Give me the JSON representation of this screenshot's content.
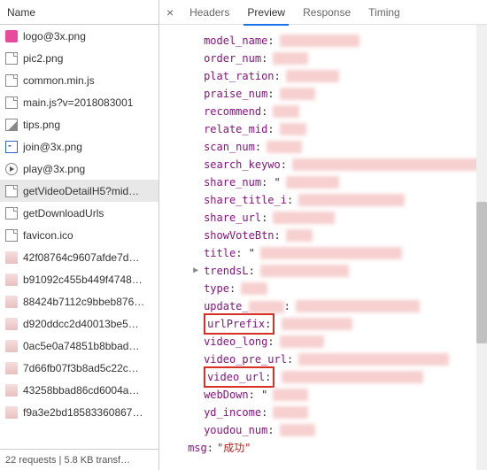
{
  "sidebar": {
    "header": "Name",
    "files": [
      {
        "name": "logo@3x.png",
        "icon": "pink"
      },
      {
        "name": "pic2.png",
        "icon": "doc"
      },
      {
        "name": "common.min.js",
        "icon": "doc"
      },
      {
        "name": "main.js?v=2018083001",
        "icon": "doc"
      },
      {
        "name": "tips.png",
        "icon": "img"
      },
      {
        "name": "join@3x.png",
        "icon": "join"
      },
      {
        "name": "play@3x.png",
        "icon": "play"
      },
      {
        "name": "getVideoDetailH5?mid…",
        "icon": "doc",
        "selected": true
      },
      {
        "name": "getDownloadUrls",
        "icon": "doc"
      },
      {
        "name": "favicon.ico",
        "icon": "doc"
      },
      {
        "name": "42f08764c9607afde7d…",
        "icon": "thumb"
      },
      {
        "name": "b91092c455b449f4748…",
        "icon": "thumb"
      },
      {
        "name": "88424b7112c9bbeb876…",
        "icon": "thumb"
      },
      {
        "name": "d920ddcc2d40013be5…",
        "icon": "thumb"
      },
      {
        "name": "0ac5e0a74851b8bbad…",
        "icon": "thumb"
      },
      {
        "name": "7d66fb07f3b8ad5c22c…",
        "icon": "thumb"
      },
      {
        "name": "43258bbad86cd6004a…",
        "icon": "thumb"
      },
      {
        "name": "f9a3e2bd18583360867…",
        "icon": "thumb"
      }
    ],
    "footer": "22 requests  |  5.8 KB transf…"
  },
  "tabs": {
    "close": "×",
    "items": [
      "Headers",
      "Preview",
      "Response",
      "Timing"
    ],
    "active": 1
  },
  "preview": {
    "props": [
      {
        "key": "model_name",
        "colon": ":",
        "censor": 90
      },
      {
        "key": "order_num",
        "colon": ":",
        "censor": 40
      },
      {
        "key": "plat_ration",
        "colon": ":",
        "censor": 60
      },
      {
        "key": "praise_num",
        "colon": ":",
        "censor": 40
      },
      {
        "key": "recommend",
        "colon": ":",
        "censor": 30
      },
      {
        "key": "relate_mid",
        "colon": ":",
        "censor": 30
      },
      {
        "key": "scan_num",
        "colon": ":",
        "censor": 40
      },
      {
        "key": "search_keywo",
        "colon": ":",
        "censor": 220
      },
      {
        "key": "share_num",
        "colon": ": \"",
        "censor": 60
      },
      {
        "key": "share_title_i",
        "colon": ":",
        "censor": 120
      },
      {
        "key": "share_url",
        "colon": ":",
        "censor": 70
      },
      {
        "key": "showVoteBtn",
        "colon": ":",
        "censor": 30
      },
      {
        "key": "title",
        "colon": ": \"",
        "censor": 160
      },
      {
        "key": "trendsL",
        "colon": ":",
        "censor": 100,
        "expand": true
      },
      {
        "key": "type",
        "colon": ":",
        "censor": 30
      },
      {
        "key": "update_",
        "colon": ":",
        "censor": 140,
        "keycensor": 40
      },
      {
        "key": "urlPrefix",
        "colon": ":",
        "censor": 80,
        "boxed": true
      },
      {
        "key": "video_long",
        "colon": ":",
        "censor": 50
      },
      {
        "key": "video_pre_url",
        "colon": ":",
        "censor": 170
      },
      {
        "key": "video_url",
        "colon": ":",
        "censor": 160,
        "boxed": true
      },
      {
        "key": "webDown",
        "colon": ": \"",
        "censor": 40
      },
      {
        "key": "yd_income",
        "colon": ":",
        "censor": 40
      },
      {
        "key": "youdou_num",
        "colon": ":",
        "censor": 40
      }
    ],
    "msg_key": "msg",
    "msg_val": "\"成功\""
  }
}
